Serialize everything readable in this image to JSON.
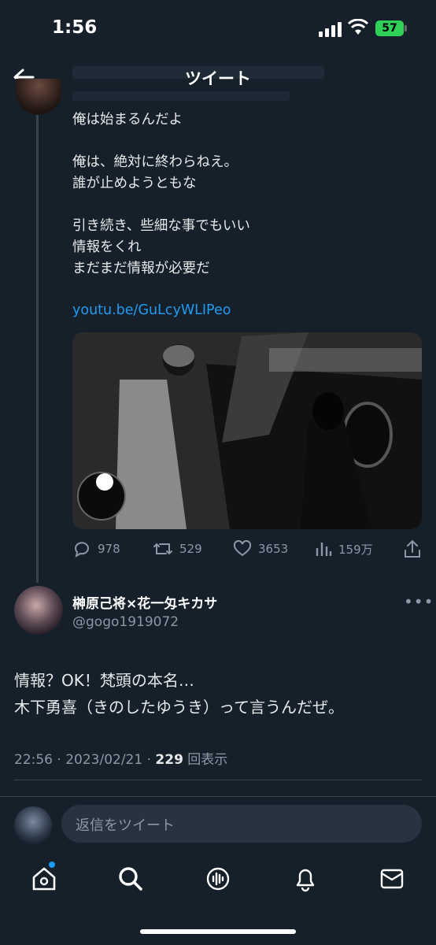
{
  "status_bar": {
    "time": "1:56",
    "battery": "57"
  },
  "header": {
    "title": "ツイート"
  },
  "parent_tweet": {
    "lines": [
      "俺は始まるんだよ",
      "俺は、絶対に終わらねえ。",
      "誰が止めようともな",
      "引き続き、些細な事でもいい",
      "情報をくれ",
      "まだまだ情報が必要だ"
    ],
    "link": "youtu.be/GuLcyWLIPeo",
    "stats": {
      "replies": "978",
      "retweets": "529",
      "likes": "3653",
      "views": "159万"
    }
  },
  "tweet": {
    "display_name": "榊原己将×花一匁キカサ",
    "handle": "@gogo1919072",
    "text_lines": [
      "情報？OK！梵頭の本名…",
      "木下勇喜（きのしたゆうき）って言うんだぜ。"
    ],
    "time": "22:56 · 2023/02/21 · ",
    "views_count": "229",
    "views_label": " 回表示"
  },
  "reply": {
    "placeholder": "返信をツイート"
  },
  "colors": {
    "background": "#15202b",
    "accent": "#1d9bf0",
    "muted": "#8b98a5"
  },
  "icons": [
    "back-arrow-icon",
    "reply-icon",
    "retweet-icon",
    "like-icon",
    "views-icon",
    "share-icon",
    "more-icon",
    "home-icon",
    "search-icon",
    "spaces-icon",
    "notifications-icon",
    "messages-icon"
  ]
}
